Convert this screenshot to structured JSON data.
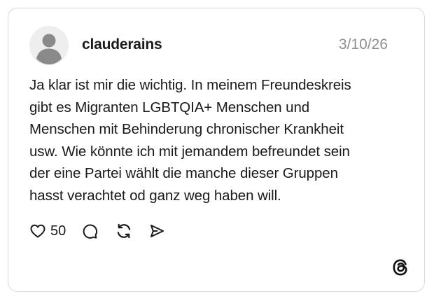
{
  "post": {
    "username": "clauderains",
    "timestamp": "3/10/26",
    "text": "Ja klar ist mir die wichtig. In meinem Freundeskreis\ngibt es Migranten LGBTQIA+ Menschen und\nMenschen mit Behinderung chronischer Krankheit\nusw. Wie könnte ich mit jemandem befreundet sein\nder eine Partei wählt die manche dieser Gruppen\nhasst verachtet od ganz weg haben will.",
    "like_count": "50"
  },
  "icons": {
    "avatar": "default-avatar-icon",
    "like": "heart-icon",
    "comment": "speech-bubble-icon",
    "repost": "repost-arrows-icon",
    "share": "send-arrow-icon",
    "brand": "threads-logo-icon"
  },
  "colors": {
    "text": "#1a1a1a",
    "muted": "#8e8e8e",
    "border": "#d9d9d9",
    "avatar_bg": "#eeeeee",
    "avatar_fg": "#8a8a8a"
  }
}
